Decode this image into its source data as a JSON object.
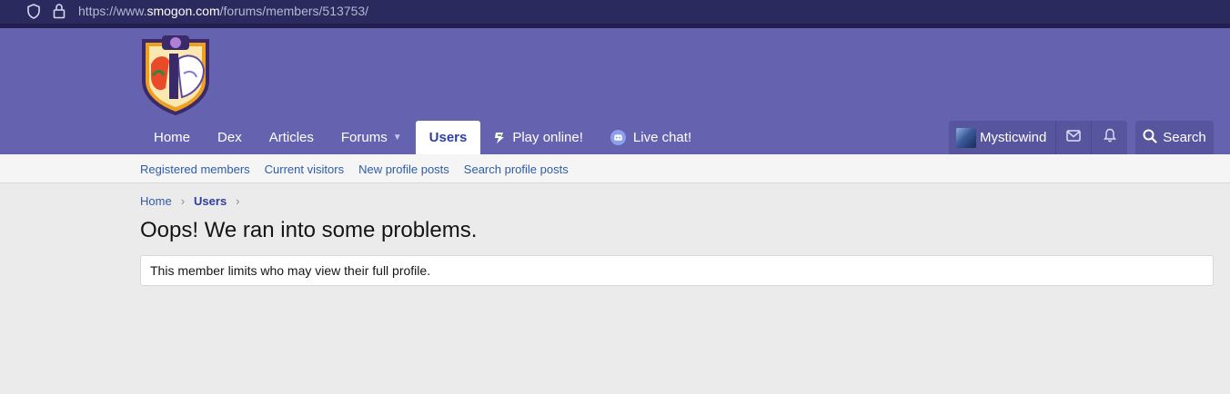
{
  "browser": {
    "url_prefix": "https://www.",
    "url_host": "smogon.com",
    "url_path": "/forums/members/513753/"
  },
  "nav": {
    "items": [
      {
        "label": "Home"
      },
      {
        "label": "Dex"
      },
      {
        "label": "Articles"
      },
      {
        "label": "Forums"
      },
      {
        "label": "Users"
      },
      {
        "label": "Play online!"
      },
      {
        "label": "Live chat!"
      }
    ],
    "active": "Users"
  },
  "account": {
    "username": "Mysticwind"
  },
  "search": {
    "label": "Search"
  },
  "subnav": {
    "items": [
      {
        "label": "Registered members"
      },
      {
        "label": "Current visitors"
      },
      {
        "label": "New profile posts"
      },
      {
        "label": "Search profile posts"
      }
    ]
  },
  "breadcrumb": {
    "items": [
      {
        "label": "Home"
      },
      {
        "label": "Users"
      }
    ]
  },
  "page": {
    "title": "Oops! We ran into some problems.",
    "message": "This member limits who may view their full profile."
  },
  "colors": {
    "header_bg": "#6563b0",
    "link": "#2f5ba8",
    "active_tab_text": "#2f41a3",
    "page_bg": "#ebebeb"
  },
  "icons": [
    "shield-icon",
    "lock-icon",
    "caret-down-icon",
    "showdown-icon",
    "discord-icon",
    "mail-icon",
    "bell-icon",
    "search-icon",
    "chevron-right-icon"
  ]
}
